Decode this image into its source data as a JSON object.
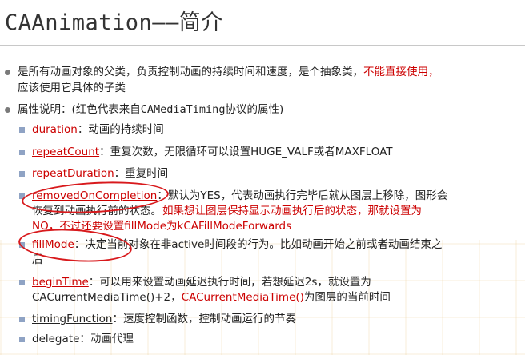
{
  "title": "CAAnimation——简介",
  "intro": {
    "line1": "是所有动画对象的父类，负责控制动画的持续时间和速度，是个抽象类，",
    "emphasis": "不能直接使用，",
    "line2": "应该使用它具体的子类"
  },
  "attrs": {
    "label": "属性说明：(红色代表来自",
    "protocol": "CAMediaTiming",
    "label_end": "协议的属性)"
  },
  "items": [
    {
      "name": "duration",
      "sep": "：",
      "desc": "动画的持续时间"
    },
    {
      "name": "repeatCount",
      "sep": "：",
      "desc": "重复次数，无限循环可以设置HUGE_VALF或者MAXFLOAT"
    },
    {
      "name": "repeatDuration",
      "sep": "：",
      "desc": "重复时间"
    },
    {
      "name": "removedOnCompletion",
      "sep": "：",
      "desc": "默认为YES，代表动画执行完毕后就从图层上移除，图形会",
      "desc2": "恢复到动画执行前的状态。"
    },
    {
      "name": "fillMode",
      "sep": "：",
      "desc": "决定当前对象在非active时间段的行为。比如动画开始之前或者动画结束之",
      "desc2": "后"
    },
    {
      "name": "beginTime",
      "sep": "：",
      "desc": "可以用来设置动画延迟执行时间，若想延迟2s，就设置为",
      "desc2a": "CACurrentMediaTime()+2，",
      "desc2b": "CACurrentMediaTime()",
      "desc2c": "为图层的当前时间"
    },
    {
      "name": "timingFunction",
      "sep": "：",
      "desc": "速度控制函数，控制动画运行的节奏"
    },
    {
      "name": "delegate",
      "sep": "：",
      "desc": "动画代理"
    }
  ],
  "annotation": {
    "line1": "如果想让图层保持显示动画执行后的状态，那就设置为",
    "line2": "NO，不过还要设置fillMode为kCAFillModeForwards"
  },
  "colors": {
    "red": "#cc0000",
    "ink": "#d8191c",
    "bullet": "#8fa3c4"
  }
}
